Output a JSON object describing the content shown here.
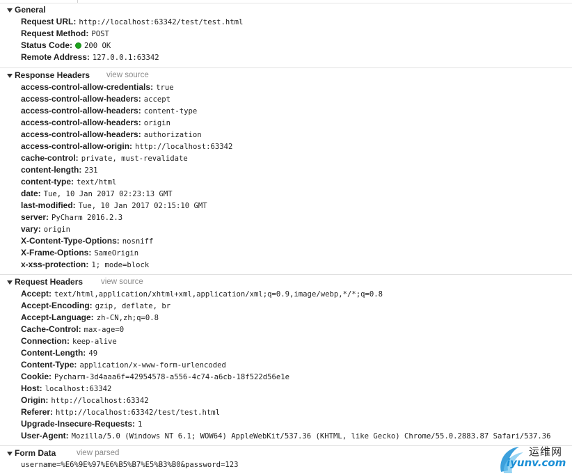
{
  "sections": {
    "general": {
      "title": "General",
      "rows": [
        {
          "key": "Request URL:",
          "value": "http://localhost:63342/test/test.html"
        },
        {
          "key": "Request Method:",
          "value": "POST"
        },
        {
          "key": "Status Code:",
          "value": "200 OK"
        },
        {
          "key": "Remote Address:",
          "value": "127.0.0.1:63342"
        }
      ]
    },
    "response_headers": {
      "title": "Response Headers",
      "link": "view source",
      "rows": [
        {
          "key": "access-control-allow-credentials:",
          "value": "true"
        },
        {
          "key": "access-control-allow-headers:",
          "value": "accept"
        },
        {
          "key": "access-control-allow-headers:",
          "value": "content-type"
        },
        {
          "key": "access-control-allow-headers:",
          "value": "origin"
        },
        {
          "key": "access-control-allow-headers:",
          "value": "authorization"
        },
        {
          "key": "access-control-allow-origin:",
          "value": "http://localhost:63342"
        },
        {
          "key": "cache-control:",
          "value": "private, must-revalidate"
        },
        {
          "key": "content-length:",
          "value": "231"
        },
        {
          "key": "content-type:",
          "value": "text/html"
        },
        {
          "key": "date:",
          "value": "Tue, 10 Jan 2017 02:23:13 GMT"
        },
        {
          "key": "last-modified:",
          "value": "Tue, 10 Jan 2017 02:15:10 GMT"
        },
        {
          "key": "server:",
          "value": "PyCharm 2016.2.3"
        },
        {
          "key": "vary:",
          "value": "origin"
        },
        {
          "key": "X-Content-Type-Options:",
          "value": "nosniff"
        },
        {
          "key": "X-Frame-Options:",
          "value": "SameOrigin"
        },
        {
          "key": "x-xss-protection:",
          "value": "1; mode=block"
        }
      ]
    },
    "request_headers": {
      "title": "Request Headers",
      "link": "view source",
      "rows": [
        {
          "key": "Accept:",
          "value": "text/html,application/xhtml+xml,application/xml;q=0.9,image/webp,*/*;q=0.8"
        },
        {
          "key": "Accept-Encoding:",
          "value": "gzip, deflate, br"
        },
        {
          "key": "Accept-Language:",
          "value": "zh-CN,zh;q=0.8"
        },
        {
          "key": "Cache-Control:",
          "value": "max-age=0"
        },
        {
          "key": "Connection:",
          "value": "keep-alive"
        },
        {
          "key": "Content-Length:",
          "value": "49"
        },
        {
          "key": "Content-Type:",
          "value": "application/x-www-form-urlencoded"
        },
        {
          "key": "Cookie:",
          "value": "Pycharm-3d4aaa6f=42954578-a556-4c74-a6cb-18f522d56e1e"
        },
        {
          "key": "Host:",
          "value": "localhost:63342"
        },
        {
          "key": "Origin:",
          "value": "http://localhost:63342"
        },
        {
          "key": "Referer:",
          "value": "http://localhost:63342/test/test.html"
        },
        {
          "key": "Upgrade-Insecure-Requests:",
          "value": "1"
        },
        {
          "key": "User-Agent:",
          "value": "Mozilla/5.0 (Windows NT 6.1; WOW64) AppleWebKit/537.36 (KHTML, like Gecko) Chrome/55.0.2883.87 Safari/537.36"
        }
      ]
    },
    "form_data": {
      "title": "Form Data",
      "link": "view parsed",
      "value": "username=%E6%9E%97%E6%B5%B7%E5%B3%B0&password=123"
    }
  },
  "watermark": {
    "cn": "运维网",
    "en": "iyunv.com"
  },
  "colors": {
    "status_ok": "#1ea51e",
    "link_gray": "#8a8a8a",
    "watermark_blue": "#1a8fd6"
  },
  "icons": {
    "section_toggle": "triangle-down-icon",
    "status": "green-dot-icon",
    "watermark": "swoosh-logo-icon"
  }
}
